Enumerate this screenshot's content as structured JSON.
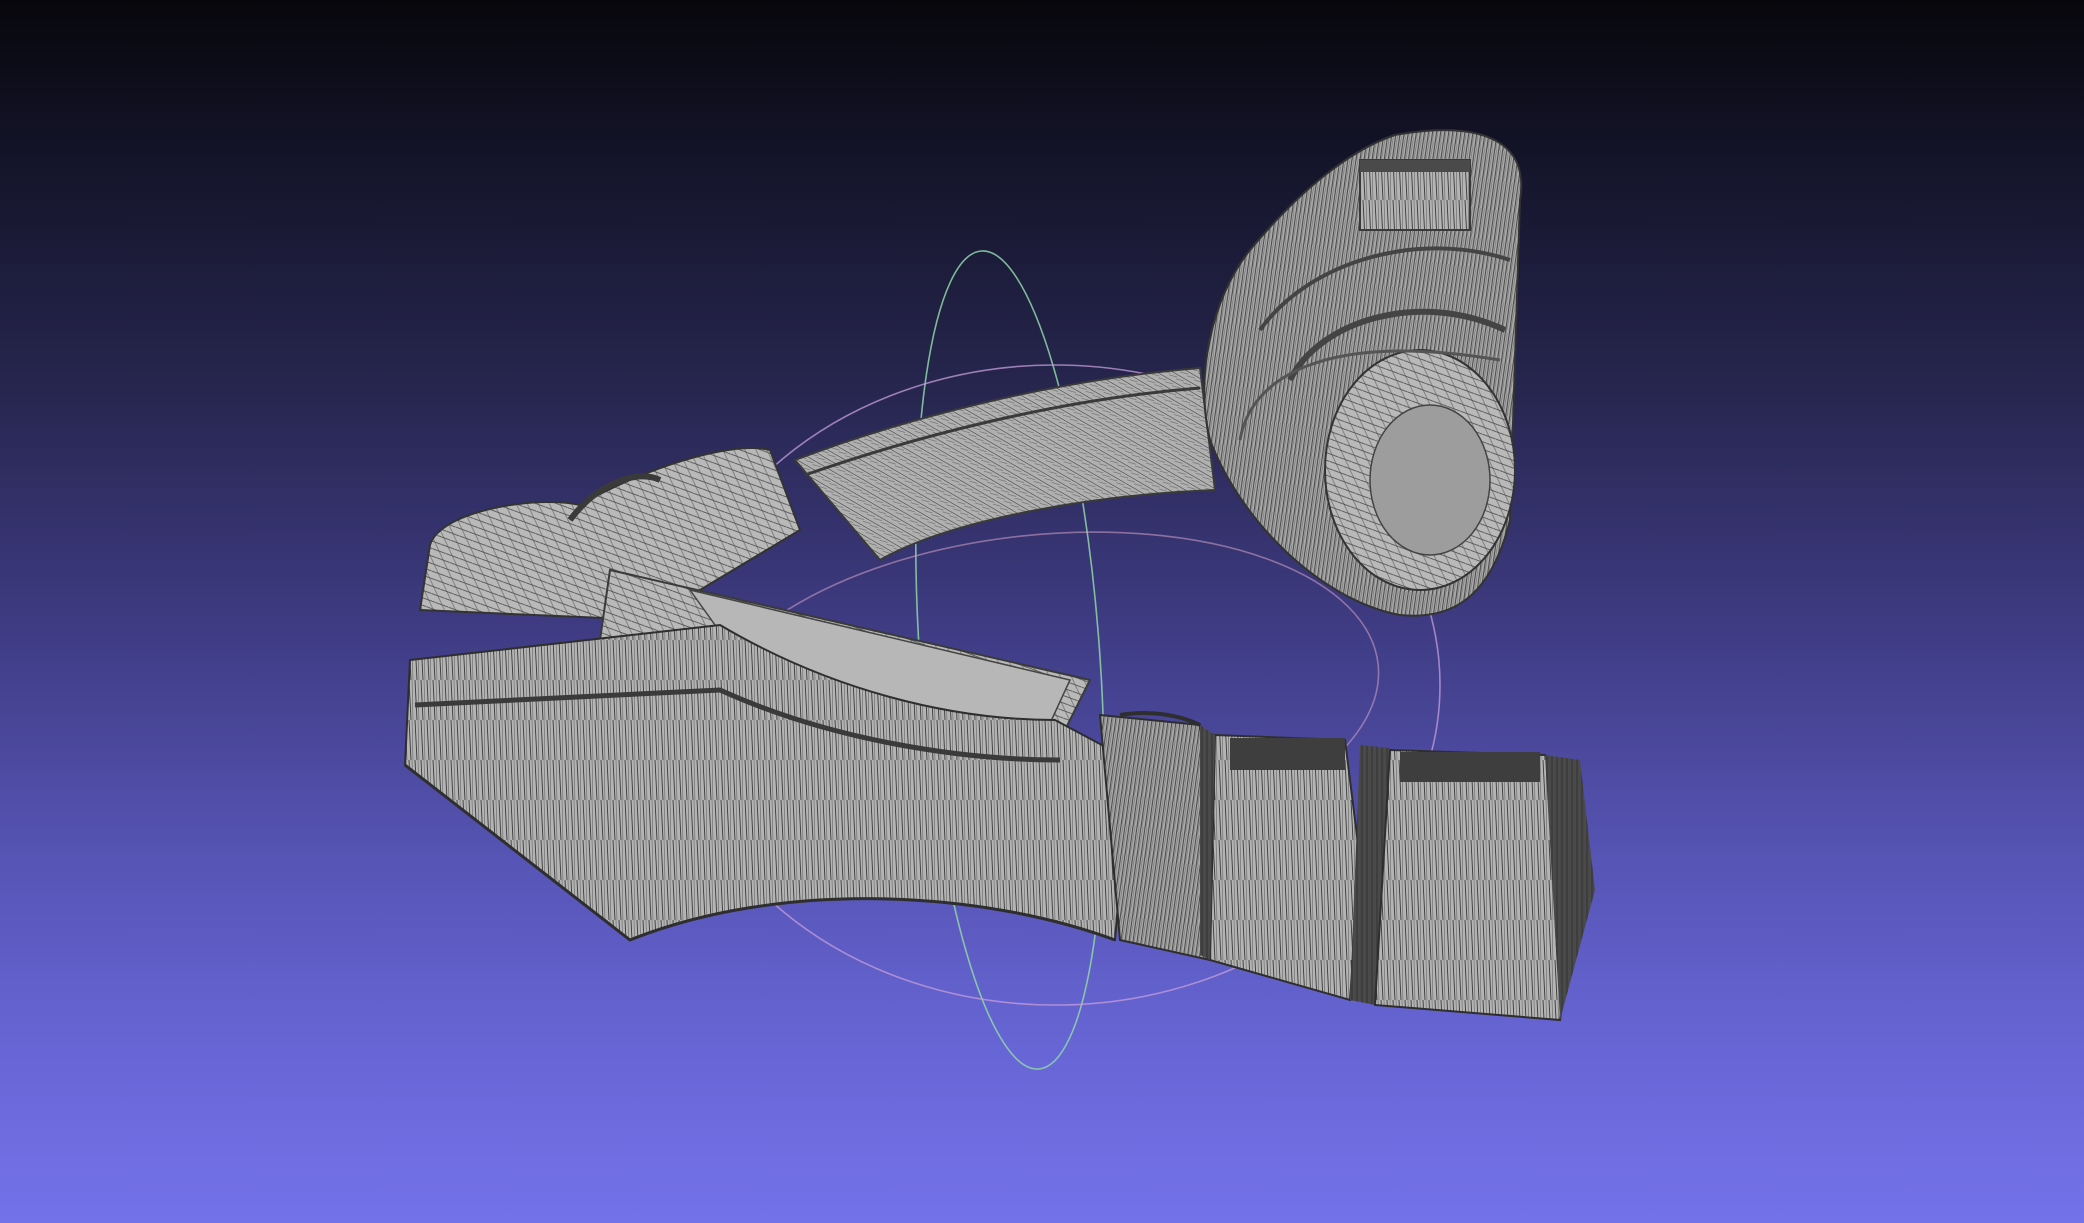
{
  "viewer": {
    "background_top": "#07070c",
    "background_bottom": "#7472e8",
    "mesh_fill": "#a9a9a9",
    "mesh_dark": "#474747",
    "wire_color": "#2e2e2e"
  },
  "trackball": {
    "ring_x_color": "#8fd6a8",
    "ring_y_color": "#c79ad8",
    "ring_z_color": "#d8a0c4"
  },
  "icons": [
    "trackball-gizmo-icon"
  ]
}
